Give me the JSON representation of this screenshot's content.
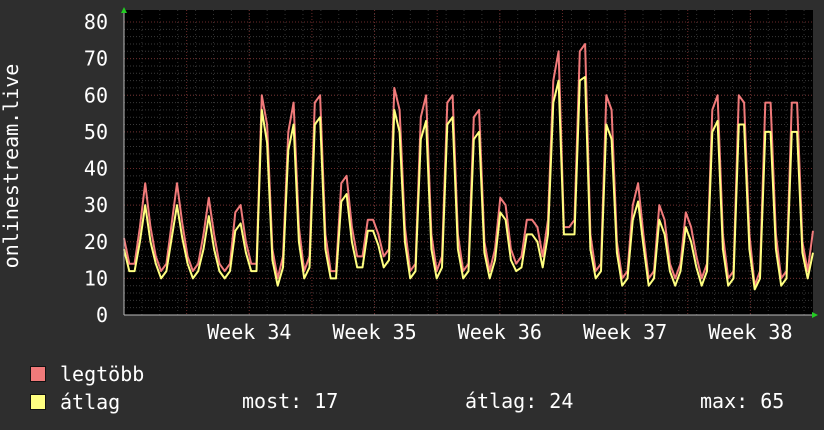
{
  "chart_data": {
    "type": "line",
    "ylabel": "onlinestream.live",
    "ylim": [
      0,
      80
    ],
    "yticks": [
      0,
      10,
      20,
      30,
      40,
      50,
      60,
      70,
      80
    ],
    "xticks": [
      {
        "label": "Week 34",
        "x": 7
      },
      {
        "label": "Week 35",
        "x": 14
      },
      {
        "label": "Week 36",
        "x": 21
      },
      {
        "label": "Week 37",
        "x": 28
      },
      {
        "label": "Week 38",
        "x": 35
      }
    ],
    "xlim": [
      0,
      38.5
    ],
    "grid": true,
    "series": [
      {
        "name": "legtöbb",
        "color": "#f07a7a",
        "values": [
          21,
          14,
          14,
          24,
          36,
          24,
          16,
          12,
          14,
          25,
          36,
          25,
          16,
          12,
          14,
          22,
          32,
          22,
          14,
          12,
          14,
          28,
          30,
          20,
          14,
          14,
          60,
          52,
          18,
          10,
          16,
          50,
          58,
          24,
          12,
          16,
          58,
          60,
          22,
          12,
          12,
          36,
          38,
          24,
          16,
          16,
          26,
          26,
          22,
          16,
          18,
          62,
          56,
          24,
          12,
          14,
          54,
          60,
          22,
          12,
          16,
          58,
          60,
          22,
          12,
          14,
          54,
          56,
          20,
          12,
          18,
          32,
          30,
          18,
          14,
          16,
          26,
          26,
          24,
          16,
          26,
          64,
          72,
          24,
          24,
          26,
          72,
          74,
          22,
          12,
          14,
          60,
          56,
          20,
          10,
          12,
          30,
          36,
          22,
          10,
          12,
          30,
          26,
          14,
          10,
          14,
          28,
          24,
          16,
          10,
          14,
          56,
          60,
          22,
          10,
          12,
          60,
          58,
          22,
          8,
          12,
          58,
          58,
          22,
          10,
          12,
          58,
          58,
          20,
          12,
          23
        ]
      },
      {
        "name": "átlag",
        "color": "#ffff80",
        "values": [
          18,
          12,
          12,
          20,
          30,
          20,
          14,
          10,
          12,
          21,
          30,
          21,
          14,
          10,
          12,
          18,
          27,
          18,
          12,
          10,
          12,
          23,
          25,
          17,
          12,
          12,
          56,
          47,
          15,
          8,
          13,
          45,
          52,
          20,
          10,
          13,
          52,
          54,
          18,
          10,
          10,
          31,
          33,
          20,
          13,
          13,
          23,
          23,
          19,
          13,
          15,
          56,
          50,
          20,
          10,
          12,
          48,
          53,
          18,
          10,
          13,
          52,
          54,
          18,
          10,
          12,
          48,
          50,
          17,
          10,
          15,
          28,
          26,
          15,
          12,
          13,
          22,
          22,
          20,
          13,
          22,
          58,
          64,
          22,
          22,
          22,
          64,
          65,
          18,
          10,
          12,
          52,
          48,
          17,
          8,
          10,
          26,
          31,
          19,
          8,
          10,
          26,
          22,
          12,
          8,
          12,
          24,
          20,
          13,
          8,
          12,
          50,
          53,
          18,
          8,
          10,
          52,
          52,
          18,
          7,
          10,
          50,
          50,
          18,
          8,
          10,
          50,
          50,
          17,
          10,
          17
        ]
      }
    ]
  },
  "legend": {
    "items": [
      {
        "label": "legtöbb",
        "color": "#f07a7a"
      },
      {
        "label": "átlag",
        "color": "#ffff80"
      }
    ],
    "stats": {
      "now": "most: 17",
      "avg": "átlag: 24",
      "max": "max: 65"
    }
  }
}
